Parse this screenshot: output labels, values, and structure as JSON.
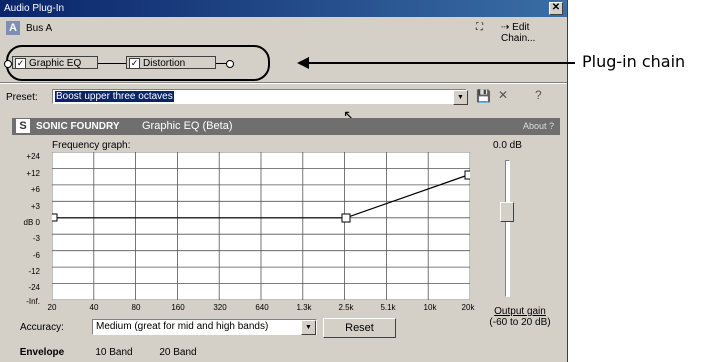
{
  "window": {
    "title": "Audio Plug-In",
    "close_glyph": "✕"
  },
  "bus": {
    "badge": "A",
    "name": "Bus A",
    "edit_chain_label": "Edit Chain..."
  },
  "chain": {
    "plugins": [
      {
        "label": "Graphic EQ",
        "checked": true
      },
      {
        "label": "Distortion",
        "checked": true
      }
    ]
  },
  "annotation": {
    "label": "Plug-in chain"
  },
  "preset": {
    "label": "Preset:",
    "value": "Boost upper three octaves"
  },
  "brand": {
    "company": "SONIC FOUNDRY",
    "plugin_title": "Graphic EQ (Beta)",
    "about_label": "About  ?"
  },
  "graph": {
    "label": "Frequency graph:",
    "gain_readout": "0.0 dB",
    "y_ticks": [
      "+24",
      "+12",
      "+6",
      "+3",
      "dB 0",
      "-3",
      "-6",
      "-12",
      "-24",
      "-Inf."
    ],
    "x_ticks": [
      "20",
      "40",
      "80",
      "160",
      "320",
      "640",
      "1.3k",
      "2.5k",
      "5.1k",
      "10k",
      "20k"
    ]
  },
  "output_gain": {
    "label": "Output gain",
    "range": "(-60 to 20 dB)"
  },
  "accuracy": {
    "label": "Accuracy:",
    "value": "Medium (great for mid and high bands)"
  },
  "reset_label": "Reset",
  "tabs": [
    {
      "label": "Envelope",
      "active": true
    },
    {
      "label": "10 Band",
      "active": false
    },
    {
      "label": "20 Band",
      "active": false
    }
  ],
  "colors": {
    "titlebar": "#0a246a",
    "selection": "#0a246a",
    "window_bg": "#d4d0c8",
    "brand_bar": "#6f6f6f"
  }
}
